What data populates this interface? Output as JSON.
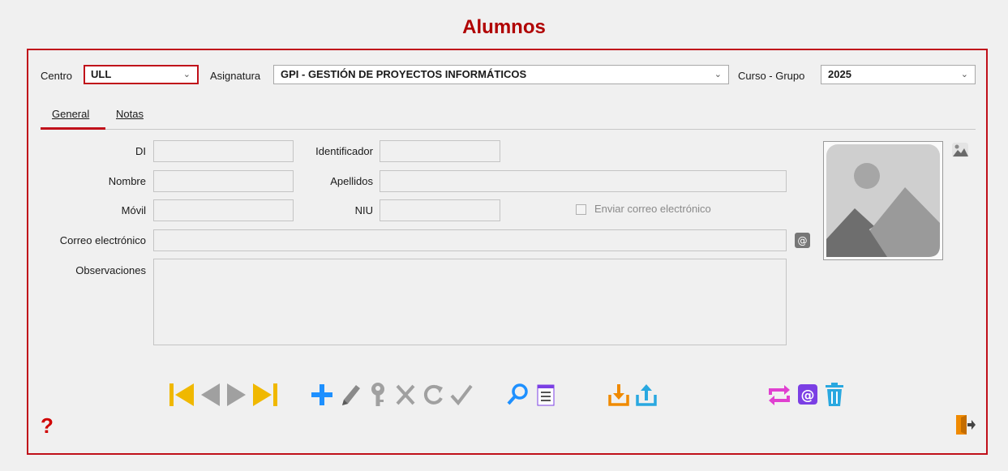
{
  "title": "Alumnos",
  "filters": {
    "centro_label": "Centro",
    "centro_value": "ULL",
    "asignatura_label": "Asignatura",
    "asignatura_value": "GPI - GESTIÓN DE PROYECTOS INFORMÁTICOS",
    "curso_label": "Curso - Grupo",
    "curso_value": "2025"
  },
  "tabs": [
    {
      "label": "General",
      "selected": true
    },
    {
      "label": "Notas",
      "selected": false
    }
  ],
  "form": {
    "di_label": "DI",
    "identificador_label": "Identificador",
    "nombre_label": "Nombre",
    "apellidos_label": "Apellidos",
    "movil_label": "Móvil",
    "niu_label": "NIU",
    "enviar_label": "Enviar correo electrónico",
    "correo_label": "Correo electrónico",
    "observaciones_label": "Observaciones"
  },
  "help_glyph": "?",
  "colors": {
    "accent": "#c0101a",
    "nav": "#f0b800",
    "nav_disabled": "#a0a0a0",
    "add": "#1e90ff",
    "import_export": "#f08a00",
    "export": "#1e90ff",
    "sync": "#e040d0",
    "email": "#7b3fe4",
    "trash": "#29a8e0",
    "exit": "#f08a00"
  },
  "icons": [
    "first-icon",
    "previous-icon",
    "next-icon",
    "last-icon",
    "add-icon",
    "edit-icon",
    "key-icon",
    "cancel-icon",
    "refresh-icon",
    "accept-icon",
    "search-icon",
    "list-icon",
    "import-icon",
    "export-icon",
    "sync-icon",
    "email-icon",
    "trash-icon",
    "exit-icon",
    "help-icon",
    "photo-icon",
    "email-at-icon"
  ]
}
